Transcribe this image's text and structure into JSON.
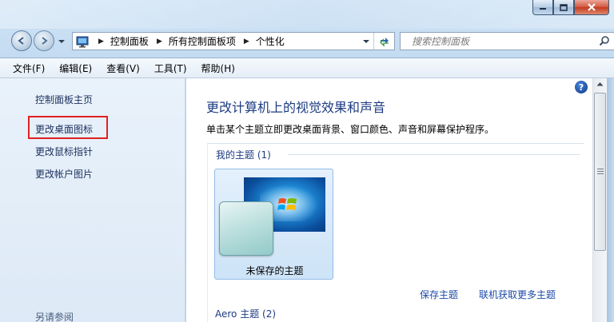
{
  "window": {
    "caption_buttons": {
      "minimize": "minimize-icon",
      "maximize": "maximize-icon",
      "close": "close-icon"
    }
  },
  "address_bar": {
    "breadcrumbs": [
      "控制面板",
      "所有控制面板项",
      "个性化"
    ],
    "search_placeholder": "搜索控制面板"
  },
  "menu": [
    "文件(F)",
    "编辑(E)",
    "查看(V)",
    "工具(T)",
    "帮助(H)"
  ],
  "sidebar": {
    "home_link": "控制面板主页",
    "links": [
      "更改桌面图标",
      "更改鼠标指针",
      "更改帐户图片"
    ],
    "see_also": "另请参阅"
  },
  "main": {
    "help_glyph": "?",
    "title": "更改计算机上的视觉效果和声音",
    "description": "单击某个主题立即更改桌面背景、窗口颜色、声音和屏幕保护程序。",
    "my_themes_header": "我的主题 (1)",
    "themes": [
      {
        "name": "未保存的主题"
      }
    ],
    "actions": {
      "save": "保存主题",
      "get_more": "联机获取更多主题"
    },
    "aero_header": "Aero 主题 (2)"
  },
  "colors": {
    "accent": "#1d3b82",
    "link": "#1c4aa8",
    "highlight_box": "#e02020"
  }
}
